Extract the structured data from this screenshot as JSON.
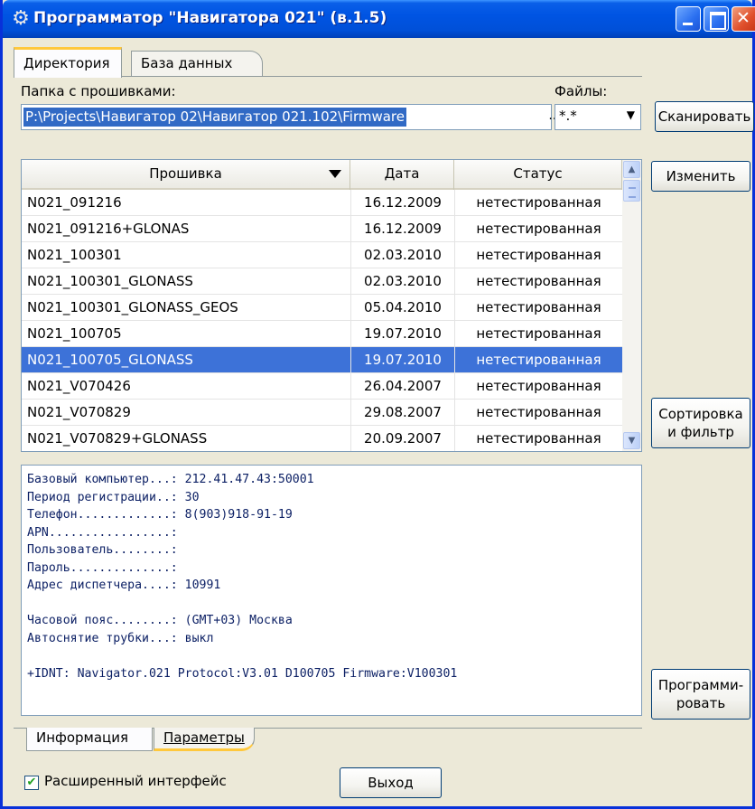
{
  "window": {
    "title": "Программатор \"Навигатора 021\" (в.1.5)"
  },
  "tabs": [
    {
      "label": "Директория",
      "active": true
    },
    {
      "label": "База данных",
      "active": false
    }
  ],
  "directory": {
    "folder_label": "Папка с прошивками:",
    "folder_path": "P:\\Projects\\Навигатор 02\\Навигатор 021.102\\Firmware",
    "browse_label": "...",
    "files_label": "Файлы:",
    "files_mask": "*.*",
    "scan_button": "Сканировать"
  },
  "grid": {
    "columns": [
      "Прошивка",
      "Дата",
      "Статус"
    ],
    "rows": [
      {
        "name": "N021_091216",
        "date": "16.12.2009",
        "status": "нетестированная"
      },
      {
        "name": "N021_091216+GLONAS",
        "date": "16.12.2009",
        "status": "нетестированная"
      },
      {
        "name": "N021_100301",
        "date": "02.03.2010",
        "status": "нетестированная"
      },
      {
        "name": "N021_100301_GLONASS",
        "date": "02.03.2010",
        "status": "нетестированная"
      },
      {
        "name": "N021_100301_GLONASS_GEOS",
        "date": "05.04.2010",
        "status": "нетестированная"
      },
      {
        "name": "N021_100705",
        "date": "19.07.2010",
        "status": "нетестированная"
      },
      {
        "name": "N021_100705_GLONASS",
        "date": "19.07.2010",
        "status": "нетестированная"
      },
      {
        "name": "N021_V070426",
        "date": "26.04.2007",
        "status": "нетестированная"
      },
      {
        "name": "N021_V070829",
        "date": "29.08.2007",
        "status": "нетестированная"
      },
      {
        "name": "N021_V070829+GLONASS",
        "date": "20.09.2007",
        "status": "нетестированная"
      }
    ],
    "selected_row": 6
  },
  "buttons": {
    "edit": "Изменить",
    "sort_line1": "Сортировка",
    "sort_line2": "и фильтр",
    "program_line1": "Программи-",
    "program_line2": "ровать",
    "exit": "Выход"
  },
  "info": {
    "lines": [
      "Базовый компьютер...: 212.41.47.43:50001",
      "Период регистрации..: 30",
      "Телефон.............: 8(903)918-91-19",
      "APN.................:",
      "Пользователь........:",
      "Пароль..............:",
      "Адрес диспетчера....: 10991",
      "",
      "Часовой пояс........: (GMT+03) Москва",
      "Автоснятие трубки...: выкл",
      "",
      "+IDNT: Navigator.021 Protocol:V3.01 D100705 Firmware:V100301"
    ]
  },
  "bottom_tabs": [
    {
      "label": "Информация",
      "active": true
    },
    {
      "label": "Параметры",
      "active": false
    }
  ],
  "extended_interface": {
    "label": "Расширенный интерфейс",
    "checked": true,
    "check_glyph": "✔"
  },
  "colors": {
    "titlebar": "#0054e3",
    "selection": "#3d72d8",
    "tab_accent": "#ffc83c"
  }
}
